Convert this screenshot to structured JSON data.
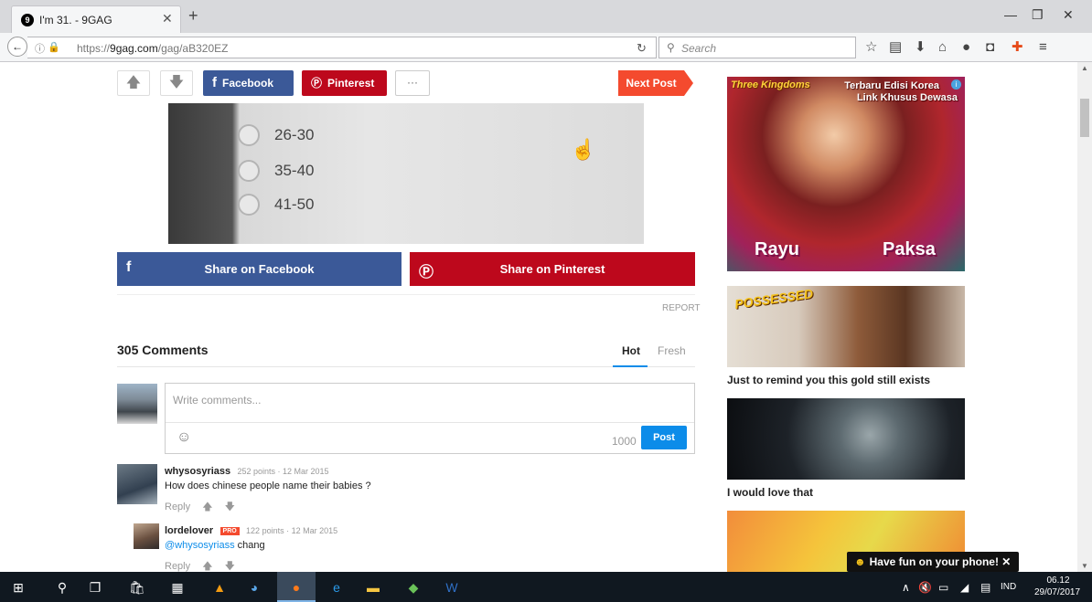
{
  "browser": {
    "tab_title": "I'm 31. - 9GAG",
    "tab_favicon": "9gag-icon",
    "url_prefix": "https://",
    "url_domain": "9gag.com",
    "url_path": "/gag/aB320EZ",
    "search_placeholder": "Search"
  },
  "post": {
    "share_facebook_small": "Facebook",
    "share_pinterest_small": "Pinterest",
    "more_label": "···",
    "next_post": "Next Post",
    "image_options": [
      "26-30",
      "35-40",
      "41-50"
    ],
    "share_facebook": "Share on Facebook",
    "share_pinterest": "Share on Pinterest",
    "report": "REPORT"
  },
  "comments": {
    "title": "305 Comments",
    "tab_hot": "Hot",
    "tab_fresh": "Fresh",
    "input_placeholder": "Write comments...",
    "char_limit": "1000",
    "post_button": "Post",
    "items": [
      {
        "user": "whysosyriass",
        "meta": "252 points · 12 Mar 2015",
        "text": "How does chinese people name their babies ?",
        "reply": "Reply"
      },
      {
        "user": "lordelover",
        "badge": "PRO",
        "meta": "122 points · 12 Mar 2015",
        "mention": "@whysosyriass",
        "text": " chang",
        "reply": "Reply"
      }
    ]
  },
  "sidebar": {
    "ad": {
      "logo": "Three Kingdoms",
      "headline1": "Terbaru Edisi Korea",
      "headline2": "Link Khusus Dewasa",
      "name1": "Rayu",
      "name2": "Paksa"
    },
    "posts": [
      {
        "caption": "POSSESSED",
        "title": "Just to remind you this gold still exists"
      },
      {
        "title": "I would love that"
      },
      {
        "title": ""
      }
    ],
    "toast": "Have fun on your phone! ✕"
  },
  "taskbar": {
    "lang": "IND",
    "time": "06.12",
    "date": "29/07/2017"
  },
  "colors": {
    "facebook": "#3b5998",
    "pinterest": "#bd081c",
    "next_post": "#f44a2e",
    "accent": "#0c8ce9"
  }
}
